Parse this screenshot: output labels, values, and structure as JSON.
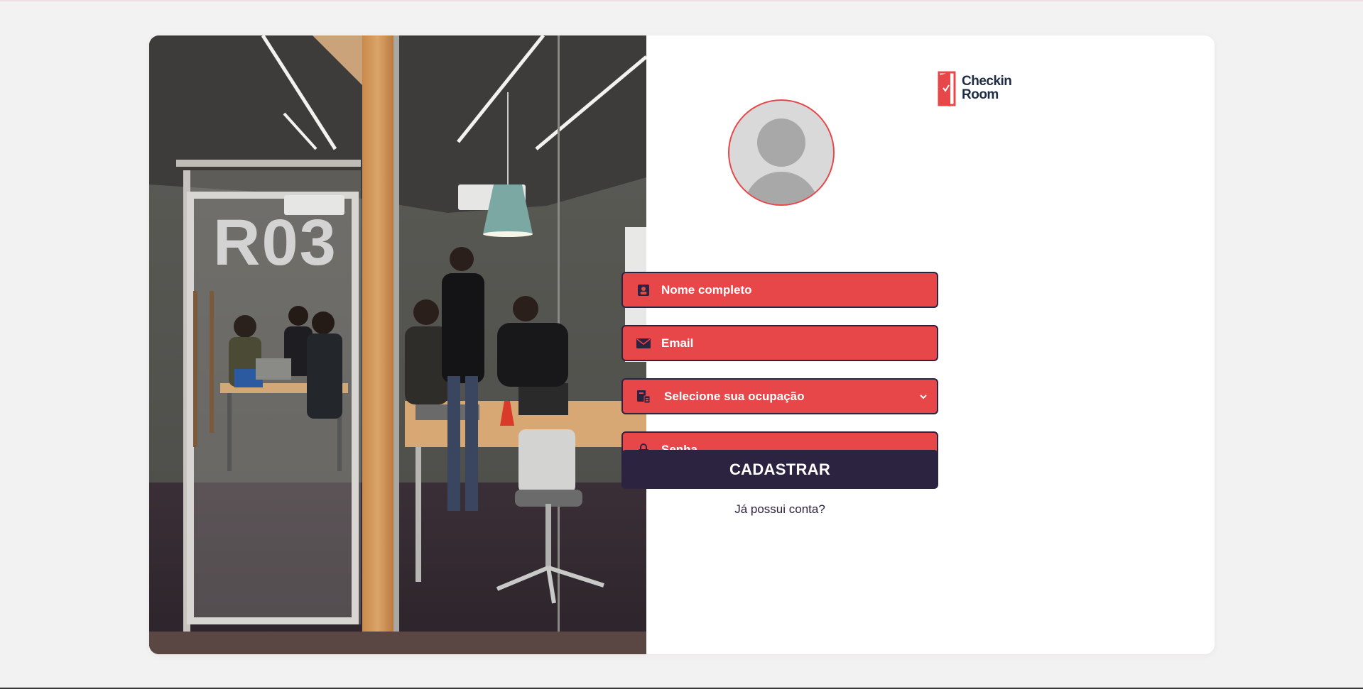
{
  "photo": {
    "room_label": "R03"
  },
  "brand": {
    "line1": "Checkin",
    "line2": "Room",
    "color": "#e8474a",
    "text_color": "#1f2c45"
  },
  "form": {
    "name_placeholder": "Nome completo",
    "email_placeholder": "Email",
    "occupation_placeholder": "Selecione sua ocupação",
    "password_placeholder": "Senha",
    "submit_label": "CADASTRAR",
    "login_link": "Já possui conta?"
  },
  "icons": {
    "avatar": "user-avatar-placeholder-icon",
    "name": "contact-card-icon",
    "email": "envelope-icon",
    "occupation": "occupation-list-icon",
    "password": "lock-icon",
    "select_arrow": "chevron-down-icon"
  },
  "colors": {
    "accent": "#e8474a",
    "dark": "#2b2340",
    "background": "#f3f2f2"
  }
}
